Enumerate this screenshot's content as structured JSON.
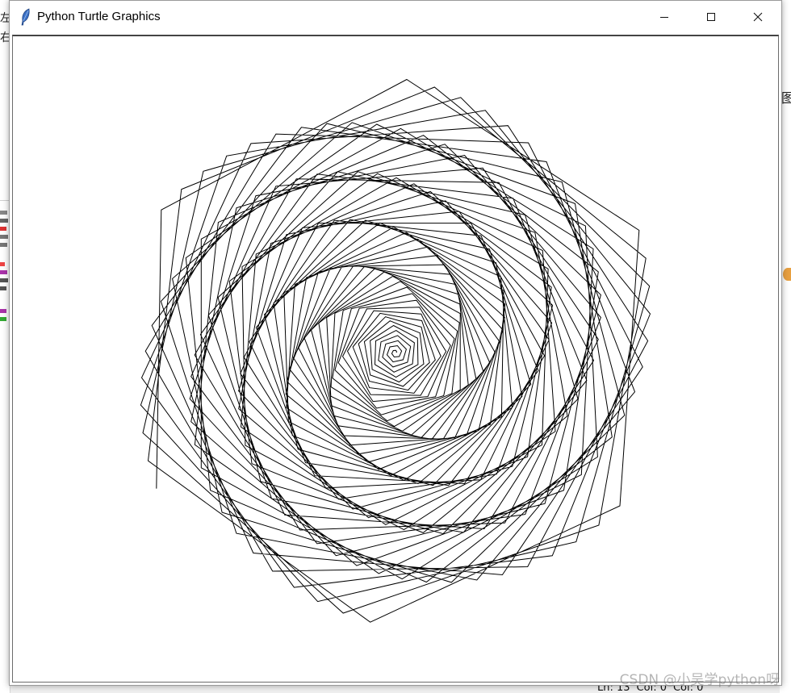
{
  "window": {
    "title": "Python Turtle Graphics"
  },
  "background": {
    "left_chars": [
      "左",
      "右"
    ],
    "right_char": "图",
    "status": {
      "ln": "Ln: 13",
      "col": "Col: 0",
      "col2": "Col: 0"
    }
  },
  "watermark": "CSDN @小吴学python呀",
  "colors": {
    "stroke": "#000000",
    "canvas_bg": "#ffffff",
    "titlebar_bg": "#ffffff"
  },
  "drawing": {
    "description_type": "turtle-spiral-polygons",
    "sides": 6,
    "steps": 330
  }
}
